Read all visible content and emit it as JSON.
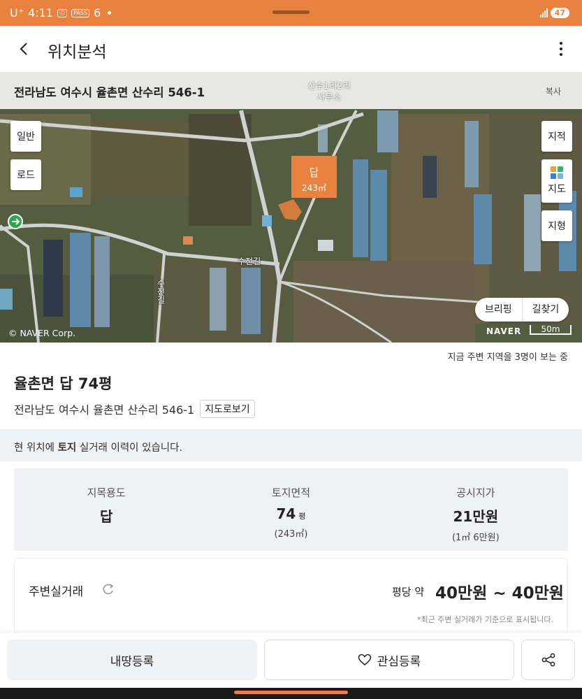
{
  "status_bar": {
    "carrier": "U⁺",
    "time": "4:11",
    "chips": [
      "Ⓒ",
      "PASS",
      "6"
    ],
    "battery": "47"
  },
  "header": {
    "title": "위치분석"
  },
  "map": {
    "address": "전라남도 여수시 율촌면 산수리 546-1",
    "copy_label": "복사",
    "poi_label_line1": "산수1리2리",
    "poi_label_line2": "사무소",
    "buttons_left": [
      "일반",
      "로드"
    ],
    "button_cadastral": "지적",
    "button_cadastral_sub": "지도",
    "button_terrain": "지형",
    "marker_category": "답",
    "marker_area": "243㎡",
    "road_label_1": "수전길",
    "road_label_2": "수전길",
    "pill_left": "브리핑",
    "pill_right": "길찾기",
    "logo": "NAVER",
    "scale": "50m",
    "copyright": "© NAVER Corp.",
    "colors": {
      "marker": "#e8823e",
      "field": "#5b6442",
      "road": "#cfd2cf",
      "greenhouse": "#5d89ad"
    }
  },
  "info": {
    "viewers": "지금 주변 지역을 3명이 보는 중",
    "title": "율촌면 답 74평",
    "address": "전라남도 여수시 율촌면 산수리 546-1",
    "map_view_button": "지도로보기",
    "history_prefix": "현 위치에 ",
    "history_bold": "토지",
    "history_suffix": " 실거래 이력이 있습니다.",
    "stats": [
      {
        "label": "지목용도",
        "value": "답",
        "unit": "",
        "sub": ""
      },
      {
        "label": "토지면적",
        "value": "74",
        "unit": "평",
        "sub": "(243㎡)"
      },
      {
        "label": "공시지가",
        "value": "21만원",
        "unit": "",
        "sub": "(1㎡ 6만원)"
      }
    ],
    "nearby": {
      "title": "주변실거래",
      "price_prefix": "평당 약",
      "price_range": "40만원 ~ 40만원",
      "note": "*최근 주변 실거래가 기준으로 표시됩니다."
    }
  },
  "bottom": {
    "register_label": "내땅등록",
    "favorite_label": "관심등록"
  }
}
